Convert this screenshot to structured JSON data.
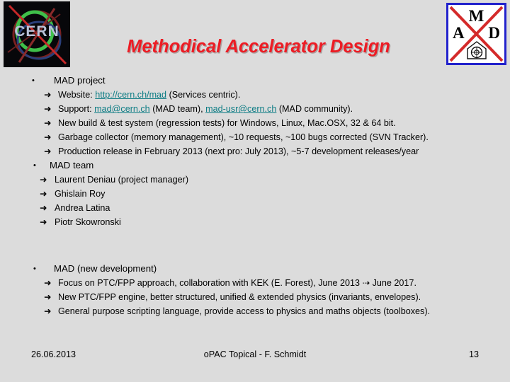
{
  "header": {
    "title": "Methodical Accelerator Design",
    "title_color": "#ED1C24",
    "cern_logo_alt": "CERN",
    "cern_text": "CERN",
    "mad_logo": {
      "letter_top": "M",
      "letter_left": "A",
      "letter_right": "D",
      "border_color": "#2222cc",
      "cross_color": "#d42a2a"
    }
  },
  "background_color": "#dcdcdc",
  "content": {
    "groups": [
      {
        "heading": "MAD project",
        "bullet_glyph": "•",
        "items": [
          {
            "arrow_glyph": "➜",
            "parts": [
              {
                "type": "text",
                "value": "Website: "
              },
              {
                "type": "link",
                "value": "http://cern.ch/mad"
              },
              {
                "type": "text",
                "value": " (Services centric)."
              }
            ]
          },
          {
            "arrow_glyph": "➜",
            "parts": [
              {
                "type": "text",
                "value": "Support: "
              },
              {
                "type": "link",
                "value": "mad@cern.ch"
              },
              {
                "type": "text",
                "value": " (MAD team), "
              },
              {
                "type": "link",
                "value": "mad-usr@cern.ch"
              },
              {
                "type": "text",
                "value": " (MAD community)."
              }
            ]
          },
          {
            "arrow_glyph": "➜",
            "parts": [
              {
                "type": "text",
                "value": "New build & test system (regression tests) for Windows, Linux, Mac.OSX, 32 & 64 bit."
              }
            ]
          },
          {
            "arrow_glyph": "➜",
            "parts": [
              {
                "type": "text",
                "value": "Garbage collector (memory management), ~10 requests, ~100 bugs corrected (SVN Tracker)."
              }
            ]
          },
          {
            "arrow_glyph": "➜",
            "parts": [
              {
                "type": "text",
                "value": "Production release in February 2013 (next pro: July 2013), ~5-7 development releases/year"
              }
            ]
          }
        ]
      },
      {
        "heading": "MAD team",
        "bullet_glyph": "•",
        "items": [
          {
            "arrow_glyph": "➜",
            "parts": [
              {
                "type": "text",
                "value": "Laurent Deniau (project manager)"
              }
            ]
          },
          {
            "arrow_glyph": "➜",
            "parts": [
              {
                "type": "text",
                "value": "Ghislain Roy"
              }
            ]
          },
          {
            "arrow_glyph": "➜",
            "parts": [
              {
                "type": "text",
                "value": "Andrea Latina"
              }
            ]
          },
          {
            "arrow_glyph": "➜",
            "parts": [
              {
                "type": "text",
                "value": "Piotr Skowronski"
              }
            ]
          }
        ]
      },
      {
        "heading": "MAD (new development)",
        "bullet_glyph": "•",
        "items": [
          {
            "arrow_glyph": "➜",
            "parts": [
              {
                "type": "text",
                "value": "Focus on PTC/FPP approach, collaboration with KEK (E. Forest), June 2013 ⇢ June 2017."
              }
            ]
          },
          {
            "arrow_glyph": "➜",
            "parts": [
              {
                "type": "text",
                "value": "New PTC/FPP engine, better structured, unified & extended physics (invariants, envelopes)."
              }
            ]
          },
          {
            "arrow_glyph": "➜",
            "parts": [
              {
                "type": "text",
                "value": "General purpose scripting language, provide access to physics and maths objects (toolboxes)."
              }
            ]
          }
        ]
      }
    ]
  },
  "footer": {
    "date": "26.06.2013",
    "center": "oPAC Topical - F. Schmidt",
    "page_number": "13"
  }
}
